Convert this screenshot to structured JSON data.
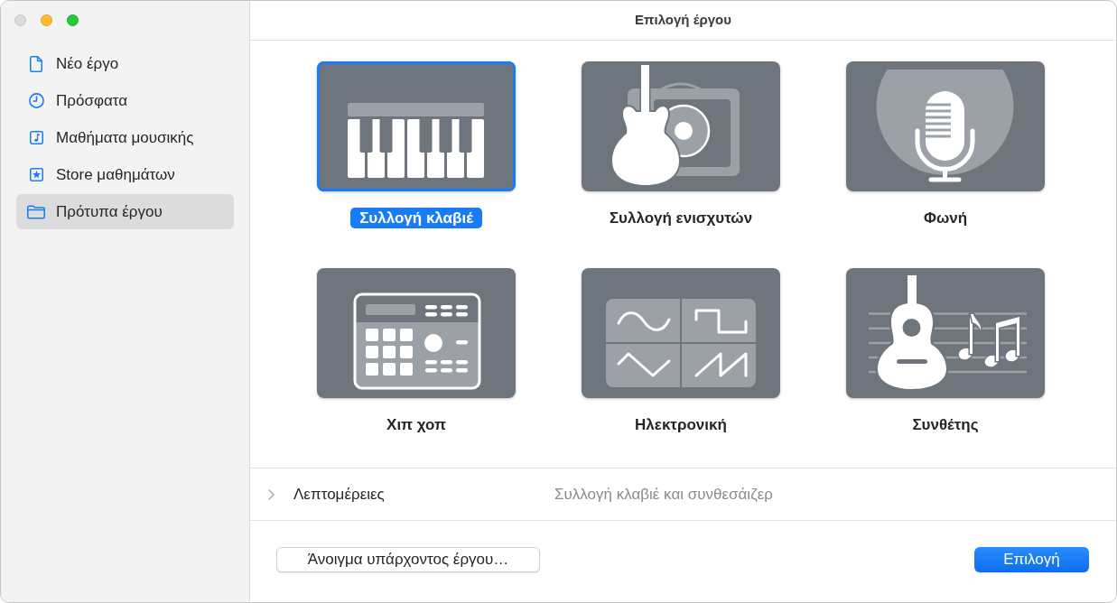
{
  "window": {
    "title": "Επιλογή έργου",
    "controls": [
      {
        "kind": "close",
        "disabled": true
      },
      {
        "kind": "minimize",
        "disabled": false
      },
      {
        "kind": "zoom",
        "disabled": false
      }
    ]
  },
  "sidebar": {
    "items": [
      {
        "label": "Νέο έργο",
        "kind": "document",
        "selected": false
      },
      {
        "label": "Πρόσφατα",
        "kind": "clock",
        "selected": false
      },
      {
        "label": "Μαθήματα μουσικής",
        "kind": "lesson",
        "selected": false
      },
      {
        "label": "Store μαθημάτων",
        "kind": "store",
        "selected": false
      },
      {
        "label": "Πρότυπα έργου",
        "kind": "folder",
        "selected": true
      }
    ]
  },
  "templates": [
    {
      "label": "Συλλογή κλαβιέ",
      "kind": "keyboard",
      "selected": true
    },
    {
      "label": "Συλλογή ενισχυτών",
      "kind": "amp",
      "selected": false
    },
    {
      "label": "Φωνή",
      "kind": "voice",
      "selected": false
    },
    {
      "label": "Χιπ χοπ",
      "kind": "drum-machine",
      "selected": false
    },
    {
      "label": "Ηλεκτρονική",
      "kind": "electronic",
      "selected": false
    },
    {
      "label": "Συνθέτης",
      "kind": "songwriter",
      "selected": false
    }
  ],
  "details": {
    "label": "Λεπτομέρειες",
    "expanded": false,
    "description": "Συλλογή κλαβιέ και συνθεσάιζερ"
  },
  "buttons": [
    {
      "label": "Άνοιγμα υπάρχοντος έργου…",
      "kind": "secondary"
    },
    {
      "label": "Επιλογή",
      "kind": "primary"
    }
  ]
}
